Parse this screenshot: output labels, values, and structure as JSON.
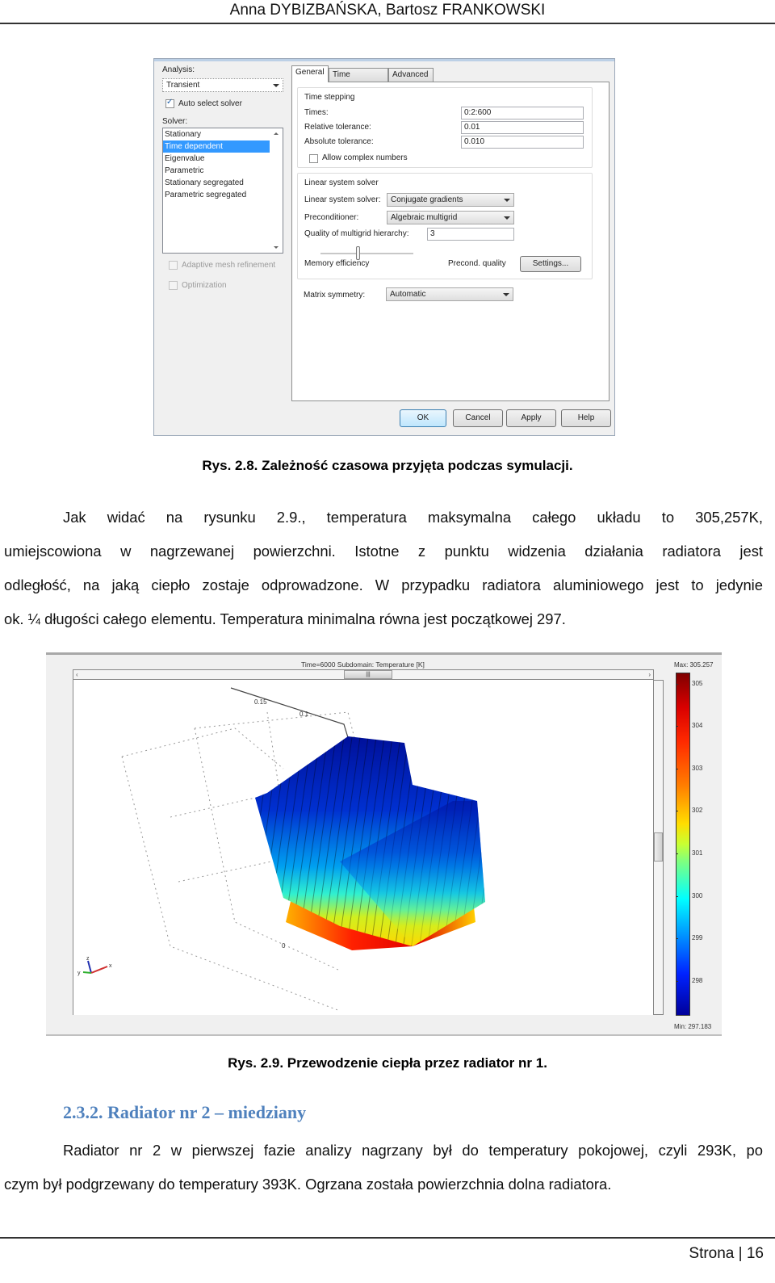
{
  "header": {
    "authors": "Anna DYBIZBAŃSKA, Bartosz FRANKOWSKI"
  },
  "dialog": {
    "analysis_label": "Analysis:",
    "analysis_value": "Transient",
    "auto_select_solver_label": "Auto select solver",
    "auto_select_solver_checked": true,
    "solver_label": "Solver:",
    "solvers": [
      "Stationary",
      "Time dependent",
      "Eigenvalue",
      "Parametric",
      "Stationary segregated",
      "Parametric segregated"
    ],
    "selected_solver": "Time dependent",
    "adaptive_mesh_label": "Adaptive mesh refinement",
    "optimization_label": "Optimization",
    "tabs": [
      {
        "label": "General",
        "active": true
      },
      {
        "label": "Time Stepping",
        "active": false
      },
      {
        "label": "Advanced",
        "active": false
      }
    ],
    "time_stepping": {
      "group_label": "Time stepping",
      "times_label": "Times:",
      "times_value": "0:2:600",
      "rel_tol_label": "Relative tolerance:",
      "rel_tol_value": "0.01",
      "abs_tol_label": "Absolute tolerance:",
      "abs_tol_value": "0.010",
      "complex_label": "Allow complex numbers",
      "complex_checked": false
    },
    "linear_solver": {
      "group_label": "Linear system solver",
      "solver_label": "Linear system solver:",
      "solver_value": "Conjugate gradients",
      "precond_label": "Preconditioner:",
      "precond_value": "Algebraic multigrid",
      "quality_label": "Quality of multigrid hierarchy:",
      "quality_value": "3",
      "memory_label": "Memory efficiency",
      "precond_quality_label": "Precond. quality",
      "slider_fraction": 0.4,
      "settings_button": "Settings..."
    },
    "matrix_symmetry_label": "Matrix symmetry:",
    "matrix_symmetry_value": "Automatic",
    "buttons": {
      "ok": "OK",
      "cancel": "Cancel",
      "apply": "Apply",
      "help": "Help"
    }
  },
  "caption_2_8": "Rys. 2.8. Zależność czasowa przyjęta podczas symulacji.",
  "paragraph1": [
    "Jak widać na rysunku 2.9., temperatura maksymalna całego układu to 305,257K,",
    "umiejscowiona w nagrzewanej powierzchni. Istotne z punktu widzenia działania radiatora jest",
    "odległość, na jaką ciepło zostaje odprowadzone. W przypadku radiatora aluminiowego jest to jedynie",
    "ok. ¼ długości całego elementu. Temperatura minimalna równa jest początkowej 297."
  ],
  "figure_2_9": {
    "plot_title": "Time=6000   Subdomain: Temperature [K]",
    "axis_ticks": [
      "0.15",
      "0.1",
      "0"
    ],
    "triad": {
      "x": "x",
      "y": "y",
      "z": "z"
    },
    "colorbar": {
      "max_label": "Max: 305.257",
      "min_label": "Min: 297.183",
      "ticks": [
        "305",
        "304",
        "303",
        "302",
        "301",
        "300",
        "299",
        "298"
      ],
      "max": 305.257,
      "min": 297.183
    }
  },
  "caption_2_9": "Rys. 2.9. Przewodzenie ciepła przez radiator nr 1.",
  "section_heading": "2.3.2.   Radiator nr 2 – miedziany",
  "paragraph2": [
    "Radiator nr 2 w pierwszej fazie analizy nagrzany był do temperatury pokojowej, czyli 293K, po",
    "czym był podgrzewany do temperatury 393K. Ogrzana została powierzchnia dolna radiatora."
  ],
  "footer": {
    "page_label": "Strona | 16"
  }
}
